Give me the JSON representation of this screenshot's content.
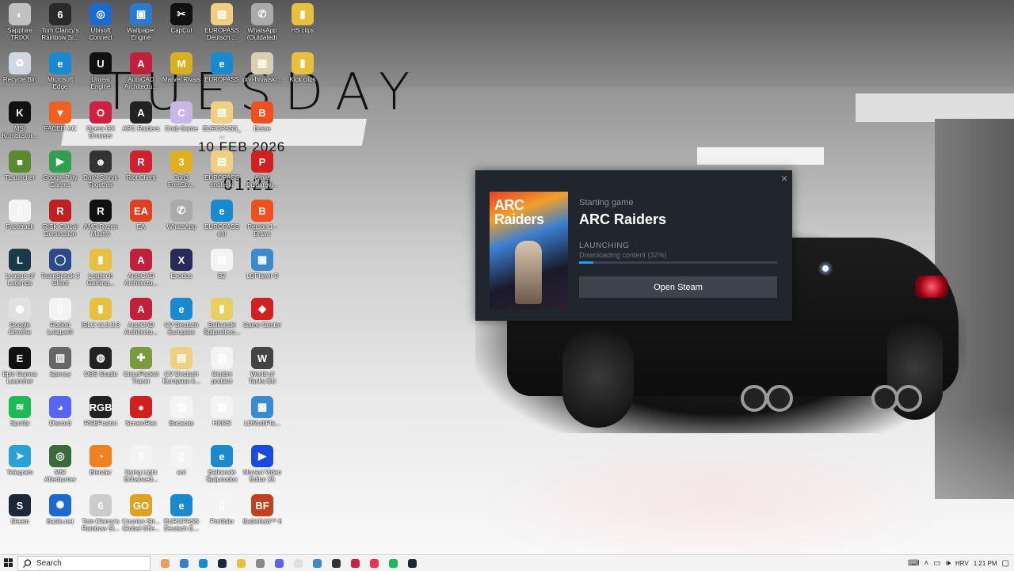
{
  "clock": {
    "day": "TUESDAY",
    "date": "10 FEB 2026",
    "time": "01:21"
  },
  "desktop_icons": [
    {
      "label": "Sapphire TRIXX",
      "color": "#c0c0c0",
      "glyph": "◐"
    },
    {
      "label": "Tom Clancy's Rainbow Si...",
      "color": "#2a2a2a",
      "glyph": "6"
    },
    {
      "label": "Ubisoft Connect",
      "color": "#1a6ad0",
      "glyph": "◎"
    },
    {
      "label": "Wallpaper Engine",
      "color": "#2a7bd0",
      "glyph": "▣"
    },
    {
      "label": "CapCut",
      "color": "#111",
      "glyph": "✂"
    },
    {
      "label": "EUROPASS Deutsch ...",
      "color": "#f0d080",
      "glyph": "▤"
    },
    {
      "label": "WhatsApp (Outdated)",
      "color": "#aaa",
      "glyph": "✆"
    },
    {
      "label": "HS clips",
      "color": "#e8c040",
      "glyph": "▮"
    },
    {
      "label": "Recycle Bin",
      "color": "#cfd8e0",
      "glyph": "♻"
    },
    {
      "label": "Microsoft Edge",
      "color": "#1a8ad0",
      "glyph": "e"
    },
    {
      "label": "Unreal Engine",
      "color": "#111",
      "glyph": "U"
    },
    {
      "label": "AutoCAD Architectu...",
      "color": "#c0203a",
      "glyph": "A"
    },
    {
      "label": "Marvel Rivals",
      "color": "#d8b020",
      "glyph": "M"
    },
    {
      "label": "EUROPASS",
      "color": "#1a8ad0",
      "glyph": "e"
    },
    {
      "label": "prvi-hrvatski...",
      "color": "#d8d0b0",
      "glyph": "▤"
    },
    {
      "label": "Kick clips",
      "color": "#e8c040",
      "glyph": "▮"
    },
    {
      "label": "MSI Kombustor...",
      "color": "#111",
      "glyph": "K"
    },
    {
      "label": "FACEIT AC",
      "color": "#f06020",
      "glyph": "▼"
    },
    {
      "label": "Opera GX Browser",
      "color": "#d02040",
      "glyph": "O"
    },
    {
      "label": "ARC Raiders",
      "color": "#222",
      "glyph": "A"
    },
    {
      "label": "Crab Game",
      "color": "#c8b8e8",
      "glyph": "C"
    },
    {
      "label": "EUROPASS_...",
      "color": "#f0d080",
      "glyph": "▤"
    },
    {
      "label": "Brave",
      "color": "#f05020",
      "glyph": "B"
    },
    {
      "label": "TLauncher",
      "color": "#5a8a30",
      "glyph": "■"
    },
    {
      "label": "Google Play Games",
      "color": "#30a050",
      "glyph": "▶"
    },
    {
      "label": "Don't Starve Together",
      "color": "#333",
      "glyph": "☻"
    },
    {
      "label": "Riot Client",
      "color": "#d02030",
      "glyph": "R"
    },
    {
      "label": "3on3 FreeSty...",
      "color": "#e0b020",
      "glyph": "3"
    },
    {
      "label": "EUROPASS engleski",
      "color": "#f0d080",
      "glyph": "▤"
    },
    {
      "label": "Amat Dizdarevi...",
      "color": "#d02020",
      "glyph": "P"
    },
    {
      "label": "Facetrack",
      "color": "#f4f4f4",
      "glyph": "▯"
    },
    {
      "label": "RISK Global Domination",
      "color": "#c02020",
      "glyph": "R"
    },
    {
      "label": "AMD Ryzen Master",
      "color": "#111",
      "glyph": "R"
    },
    {
      "label": "EA",
      "color": "#e04020",
      "glyph": "EA"
    },
    {
      "label": "WhatsApp",
      "color": "#aaa",
      "glyph": "✆"
    },
    {
      "label": "EUROPASS eni",
      "color": "#1a8ad0",
      "glyph": "e"
    },
    {
      "label": "Person 1 - Brave",
      "color": "#f05020",
      "glyph": "B"
    },
    {
      "label": "League of Legends",
      "color": "#1a3a4a",
      "glyph": "L"
    },
    {
      "label": "TeamSpeak 3 Client",
      "color": "#2a4a8a",
      "glyph": "◯"
    },
    {
      "label": "Logitech Gaming...",
      "color": "#e8c040",
      "glyph": "▮"
    },
    {
      "label": "AutoCAD Architectu...",
      "color": "#c0203a",
      "glyph": "A"
    },
    {
      "label": "Exodus",
      "color": "#2a2a5a",
      "glyph": "X"
    },
    {
      "label": "B2",
      "color": "#f4f4f4",
      "glyph": "▤"
    },
    {
      "label": "LDPlayer 9",
      "color": "#3a8ad0",
      "glyph": "▦"
    },
    {
      "label": "Google Chrome",
      "color": "#e0e0e0",
      "glyph": "◉"
    },
    {
      "label": "Rocket League®",
      "color": "#f4f4f4",
      "glyph": "▯"
    },
    {
      "label": "ISLC v1.0.3.3",
      "color": "#e8c040",
      "glyph": "▮"
    },
    {
      "label": "AutoCAD Architectu...",
      "color": "#c0203a",
      "glyph": "A"
    },
    {
      "label": "CV Deutsch Europass",
      "color": "#1a8ad0",
      "glyph": "e"
    },
    {
      "label": "Balkanski Špijunobco...",
      "color": "#e8d060",
      "glyph": "▮"
    },
    {
      "label": "Game Center",
      "color": "#d02020",
      "glyph": "◆"
    },
    {
      "label": "Epic Games Launcher",
      "color": "#111",
      "glyph": "E"
    },
    {
      "label": "Speccy",
      "color": "#666",
      "glyph": "▥"
    },
    {
      "label": "OBS Studio",
      "color": "#222",
      "glyph": "◍"
    },
    {
      "label": "CiscoPacket Tracer",
      "color": "#7a9a40",
      "glyph": "✚"
    },
    {
      "label": "CV Deutsch Europass fi...",
      "color": "#f0d080",
      "glyph": "▤"
    },
    {
      "label": "Osobni podatci",
      "color": "#f4f4f4",
      "glyph": "▤"
    },
    {
      "label": "World of Tanks EU",
      "color": "#444",
      "glyph": "W"
    },
    {
      "label": "Spotify",
      "color": "#1db954",
      "glyph": "≋"
    },
    {
      "label": "Discord",
      "color": "#5865f2",
      "glyph": "◕"
    },
    {
      "label": "RGBFusion",
      "color": "#222",
      "glyph": "RGB"
    },
    {
      "label": "ScreenRec",
      "color": "#d02020",
      "glyph": "●"
    },
    {
      "label": "Bacacas",
      "color": "#f4f4f4",
      "glyph": "▤"
    },
    {
      "label": "HKMS",
      "color": "#f4f4f4",
      "glyph": "▤"
    },
    {
      "label": "LDMultiPla...",
      "color": "#3a8ad0",
      "glyph": "▦"
    },
    {
      "label": "Telegram",
      "color": "#2aa0d8",
      "glyph": "➤"
    },
    {
      "label": "MSI Afterburner",
      "color": "#3a6a3a",
      "glyph": "◎"
    },
    {
      "label": "Blender",
      "color": "#f08020",
      "glyph": "◔"
    },
    {
      "label": "Dying Light Enhanced...",
      "color": "#f4f4f4",
      "glyph": "▯"
    },
    {
      "label": "eni",
      "color": "#f4f4f4",
      "glyph": "▯"
    },
    {
      "label": "Balkanski Špijunodox",
      "color": "#1a8ad0",
      "glyph": "e"
    },
    {
      "label": "Movavi Video Editor 25",
      "color": "#1a4ae0",
      "glyph": "▶"
    },
    {
      "label": "Steam",
      "color": "#1b2838",
      "glyph": "S"
    },
    {
      "label": "Battle.net",
      "color": "#1a6ad0",
      "glyph": "✺"
    },
    {
      "label": "Tom Clancy's Rainbow Si...",
      "color": "#ccc",
      "glyph": "6"
    },
    {
      "label": "Counter-Str... Global Offe...",
      "color": "#e0a020",
      "glyph": "GO"
    },
    {
      "label": "EUROPASS Deutsch E...",
      "color": "#1a8ad0",
      "glyph": "e"
    },
    {
      "label": "Portfolio",
      "color": "#f4f4f4",
      "glyph": "▯"
    },
    {
      "label": "Battlefield™ 6",
      "color": "#c04020",
      "glyph": "BF"
    }
  ],
  "steam_dialog": {
    "status": "Starting game",
    "game": "ARC Raiders",
    "cover_title": "ARC Raiders",
    "phase": "LAUNCHING",
    "progress_text": "Downloading content (32%)",
    "progress_fraction": 0.07,
    "open_button": "Open Steam",
    "close_glyph": "×"
  },
  "taskbar": {
    "search_placeholder": "Search",
    "apps": [
      "#e8a060",
      "#3a7ad0",
      "#1a8ad0",
      "#1b2838",
      "#e8c040",
      "#888",
      "#5865f2",
      "#e0e0e0",
      "#3a8ad0",
      "#333",
      "#d02040",
      "#f03050",
      "#1db954",
      "#1b2838"
    ],
    "lang": "HRV",
    "time": "1:21 PM"
  }
}
